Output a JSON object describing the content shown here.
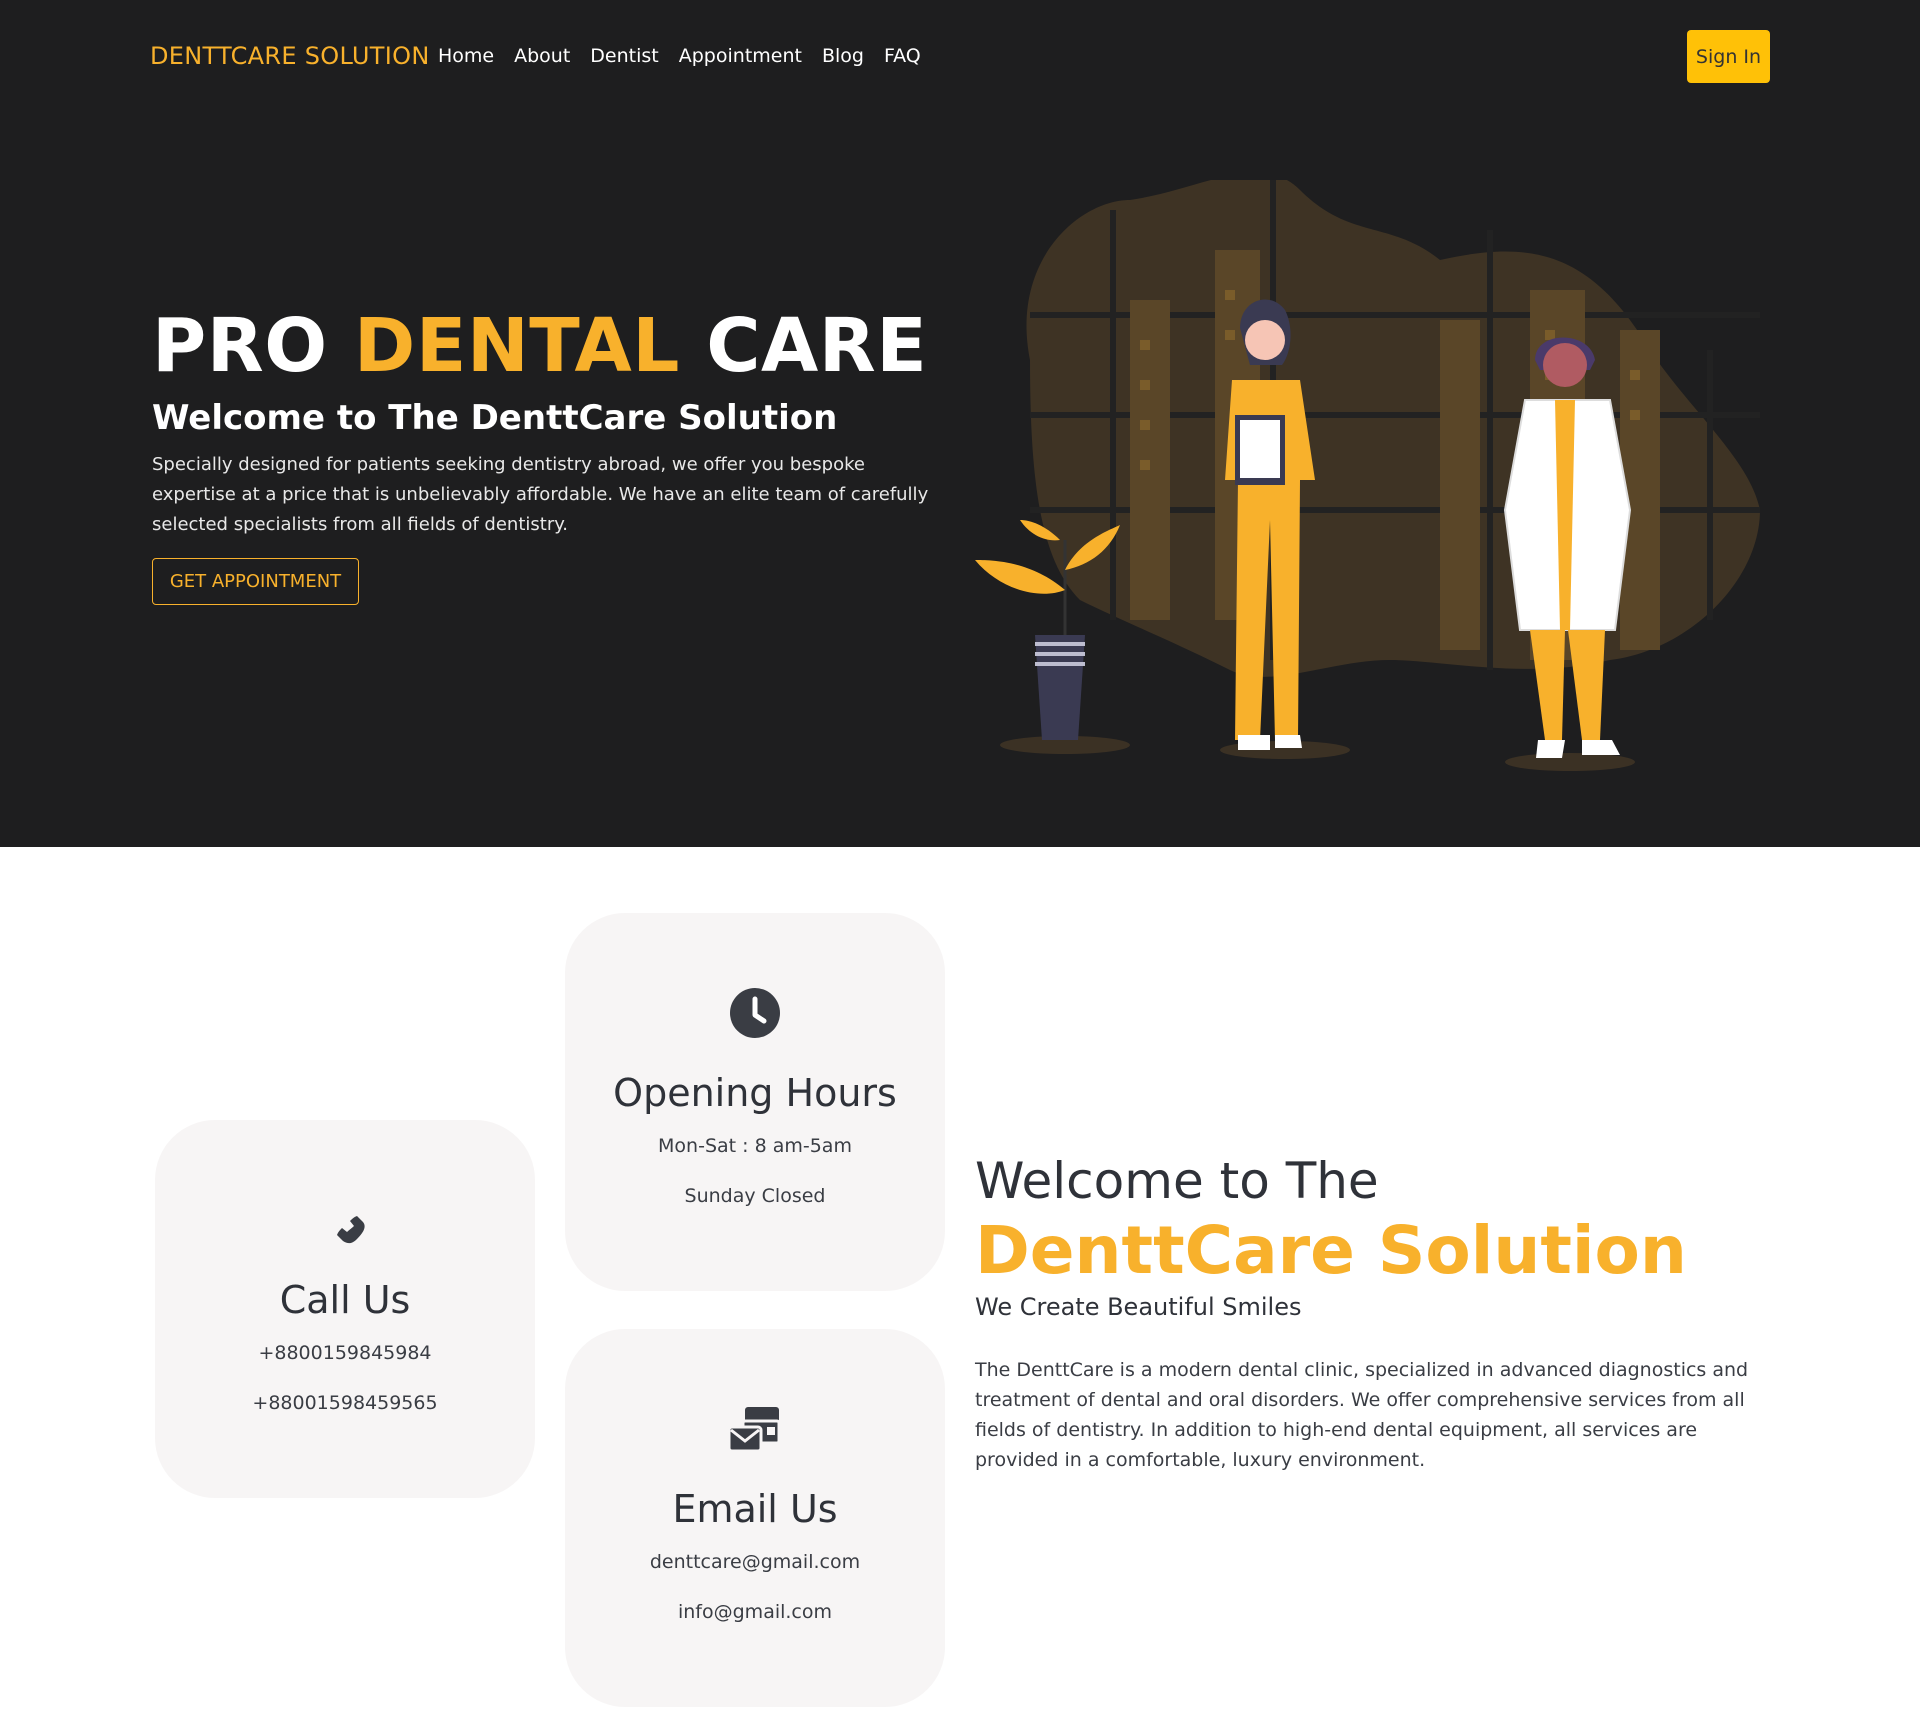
{
  "nav": {
    "brand": "DENTTCARE SOLUTION",
    "links": [
      "Home",
      "About",
      "Dentist",
      "Appointment",
      "Blog",
      "FAQ"
    ],
    "signin_label": "Sign In"
  },
  "hero": {
    "title_part1": "PRO ",
    "title_accent": "DENTAL",
    "title_part2": " CARE",
    "subtitle": "Welcome to The DenttCare Solution",
    "text": "Specially designed for patients seeking dentistry abroad, we offer you bespoke expertise at a price that is unbelievably affordable. We have an elite team of carefully selected specialists from all fields of dentistry.",
    "button_label": "GET APPOINTMENT",
    "illustration_icon": "dentists-illustration"
  },
  "cards": {
    "call": {
      "icon": "phone-icon",
      "title": "Call Us",
      "line1": "+8800159845984",
      "line2": "+88001598459565"
    },
    "hours": {
      "icon": "clock-icon",
      "title": "Opening Hours",
      "line1": "Mon-Sat : 8 am-5am",
      "line2": "Sunday Closed"
    },
    "email": {
      "icon": "envelopes-icon",
      "title": "Email Us",
      "line1": "denttcare@gmail.com",
      "line2": "info@gmail.com"
    }
  },
  "welcome": {
    "heading": "Welcome to The",
    "brand": "DenttCare Solution",
    "tagline": "We Create Beautiful Smiles",
    "text": "The DenttCare is a modern dental clinic, specialized in advanced diagnostics and treatment of dental and oral disorders. We offer comprehensive services from all fields of dentistry. In addition to high-end dental equipment, all services are provided in a comfortable, luxury environment."
  },
  "colors": {
    "accent": "#f8b12c",
    "dark_bg": "#1e1e1f",
    "signin_bg": "#ffc107",
    "card_bg": "#f7f5f5"
  }
}
